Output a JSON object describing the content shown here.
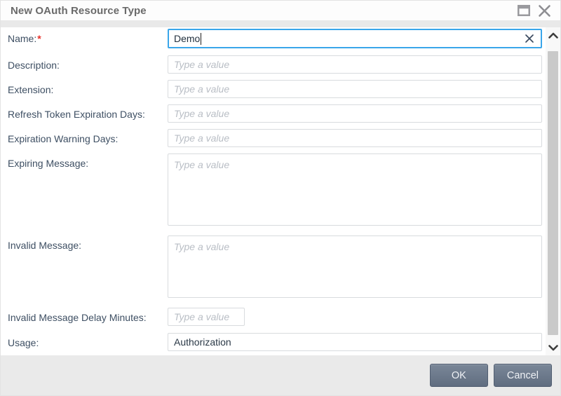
{
  "window": {
    "title": "New OAuth Resource Type",
    "maximize_icon": "maximize-icon",
    "close_icon": "close-icon"
  },
  "form": {
    "fields": [
      {
        "label": "Name:",
        "required_marker": "*",
        "value": "Demo",
        "clear_icon": "clear-x-icon"
      },
      {
        "label": "Description:",
        "placeholder": "Type a value"
      },
      {
        "label": "Extension:",
        "placeholder": "Type a value"
      },
      {
        "label": "Refresh Token Expiration Days:",
        "placeholder": "Type a value"
      },
      {
        "label": "Expiration Warning Days:",
        "placeholder": "Type a value"
      },
      {
        "label": "Expiring Message:",
        "placeholder": "Type a value"
      },
      {
        "label": "Invalid Message:",
        "placeholder": "Type a value"
      },
      {
        "label": "Invalid Message Delay Minutes:",
        "placeholder": "Type a value"
      },
      {
        "label": "Usage:",
        "value": "Authorization"
      }
    ]
  },
  "footer": {
    "ok": "OK",
    "cancel": "Cancel"
  },
  "colors": {
    "focus_border": "#3aa6ea",
    "required_asterisk": "#e8312a",
    "button_bg": "#6b7888",
    "label_text": "#3e4f63",
    "scroll_thumb": "#c9c9c9",
    "footer_bg": "#eaeaea"
  }
}
